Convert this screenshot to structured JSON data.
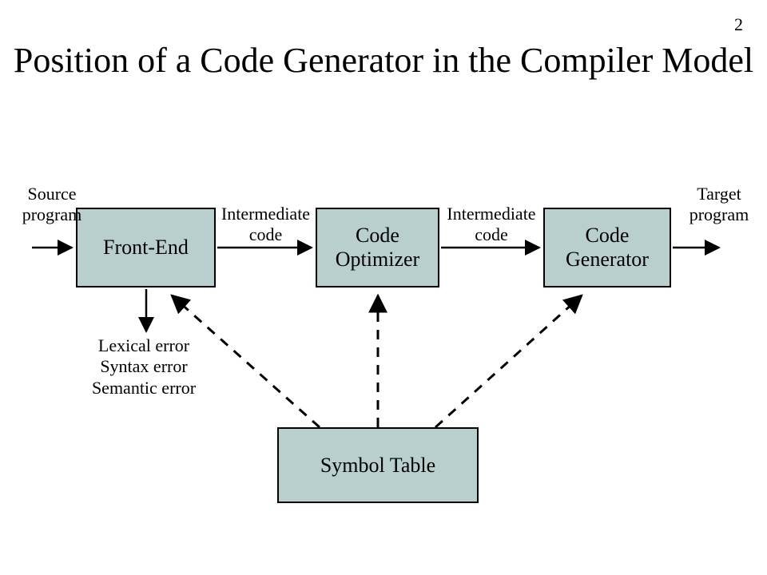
{
  "pageNumber": "2",
  "title": "Position of a Code Generator in the Compiler Model",
  "boxes": {
    "frontEnd": "Front-End",
    "codeOptimizer": "Code\nOptimizer",
    "codeGenerator": "Code\nGenerator",
    "symbolTable": "Symbol Table"
  },
  "labels": {
    "sourceProgram": "Source\nprogram",
    "intermediateCode1": "Intermediate\ncode",
    "intermediateCode2": "Intermediate\ncode",
    "targetProgram": "Target\nprogram",
    "errors": "Lexical error\nSyntax error\nSemantic error"
  }
}
